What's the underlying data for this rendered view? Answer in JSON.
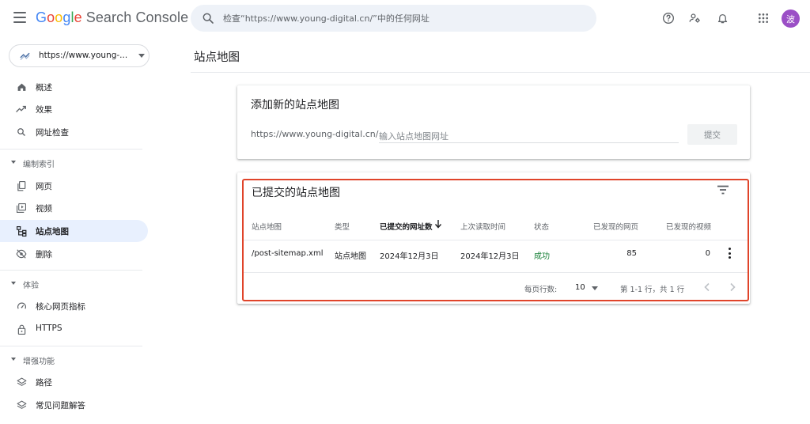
{
  "app": {
    "logo_google": [
      "G",
      "o",
      "o",
      "g",
      "l",
      "e"
    ],
    "logo_product": "Search Console",
    "search_placeholder": "检查“https://www.young-digital.cn/”中的任何网址",
    "avatar_letter": "波"
  },
  "sidebar": {
    "property_label": "https://www.young-...",
    "items_top": [
      {
        "label": "概述",
        "icon": "home-icon"
      },
      {
        "label": "效果",
        "icon": "trending-up-icon"
      },
      {
        "label": "网址检查",
        "icon": "search-icon"
      }
    ],
    "section_index": "编制索引",
    "items_index": [
      {
        "label": "网页",
        "icon": "pages-icon"
      },
      {
        "label": "视频",
        "icon": "video-icon"
      },
      {
        "label": "站点地图",
        "icon": "sitemap-icon",
        "active": true
      },
      {
        "label": "删除",
        "icon": "removals-icon"
      }
    ],
    "section_experience": "体验",
    "items_experience": [
      {
        "label": "核心网页指标",
        "icon": "gauge-icon"
      },
      {
        "label": "HTTPS",
        "icon": "lock-icon"
      }
    ],
    "section_enhancements": "增强功能",
    "items_enhancements": [
      {
        "label": "路径",
        "icon": "layers-icon"
      },
      {
        "label": "常见问题解答",
        "icon": "layers-icon"
      }
    ]
  },
  "main": {
    "page_title": "站点地图",
    "add_card": {
      "title": "添加新的站点地图",
      "prefix": "https://www.young-digital.cn/",
      "input_placeholder": "输入站点地图网址",
      "submit_label": "提交"
    },
    "submitted_card": {
      "title": "已提交的站点地图",
      "columns": [
        "站点地图",
        "类型",
        "已提交的网址数",
        "上次读取时间",
        "状态",
        "已发现的网页",
        "已发现的视频"
      ],
      "rows": [
        {
          "sitemap": "/post-sitemap.xml",
          "type": "站点地图",
          "submitted": "2024年12月3日",
          "last_read": "2024年12月3日",
          "status": "成功",
          "pages": "85",
          "videos": "0"
        }
      ],
      "rows_per_page_label": "每页行数:",
      "rows_per_page_value": "10",
      "range_label": "第 1-1 行，共 1 行"
    }
  },
  "colors": {
    "accent": "#1a73e8",
    "active_bg": "#e8f0fe",
    "success": "#188038",
    "highlight": "#e0442a",
    "avatar": "#9b4fc6"
  }
}
